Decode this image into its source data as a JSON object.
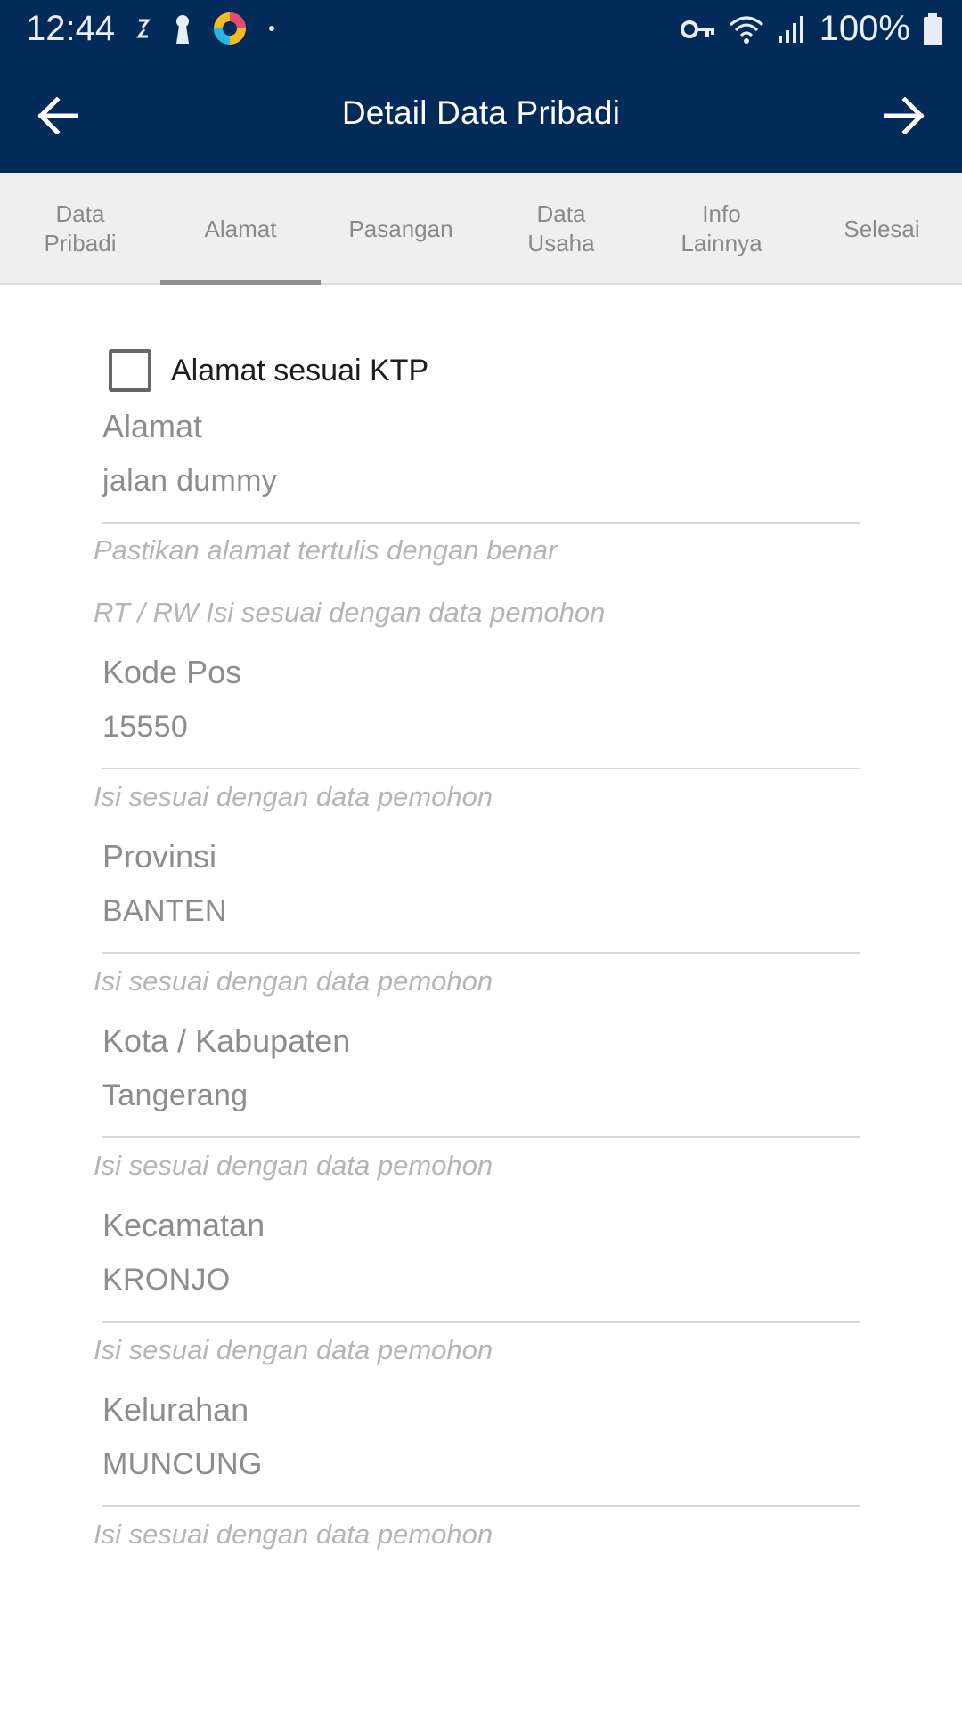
{
  "status_bar": {
    "time": "12:44",
    "battery": "100%",
    "left_icons": [
      "sync-icon",
      "lock-icon",
      "app-icon",
      "dot-icon"
    ],
    "right_icons": [
      "key-icon",
      "wifi-icon",
      "signal-icon",
      "battery-icon"
    ]
  },
  "app_bar": {
    "title": "Detail Data Pribadi",
    "back_icon": "arrow-left-icon",
    "forward_icon": "arrow-right-icon",
    "background": "#022b5a"
  },
  "tabs": [
    {
      "label": "Data\nPribadi",
      "active": false
    },
    {
      "label": "Alamat",
      "active": true
    },
    {
      "label": "Pasangan",
      "active": false
    },
    {
      "label": "Data\nUsaha",
      "active": false
    },
    {
      "label": "Info\nLainnya",
      "active": false
    },
    {
      "label": "Selesai",
      "active": false
    }
  ],
  "form": {
    "checkbox": {
      "label": "Alamat sesuai KTP",
      "checked": false
    },
    "alamat": {
      "label": "Alamat",
      "value": "jalan dummy",
      "hint": "Pastikan alamat tertulis dengan benar"
    },
    "rt_rw_hint": "RT / RW Isi sesuai dengan data pemohon",
    "kode_pos": {
      "label": "Kode Pos",
      "value": "15550",
      "hint": "Isi sesuai dengan data pemohon"
    },
    "provinsi": {
      "label": "Provinsi",
      "value": "BANTEN",
      "hint": "Isi sesuai dengan data pemohon"
    },
    "kota": {
      "label": "Kota / Kabupaten",
      "value": "Tangerang",
      "hint": "Isi sesuai dengan data pemohon"
    },
    "kecamatan": {
      "label": "Kecamatan",
      "value": "KRONJO",
      "hint": "Isi sesuai dengan data pemohon"
    },
    "kelurahan": {
      "label": "Kelurahan",
      "value": "MUNCUNG",
      "hint": "Isi sesuai dengan data pemohon"
    }
  }
}
